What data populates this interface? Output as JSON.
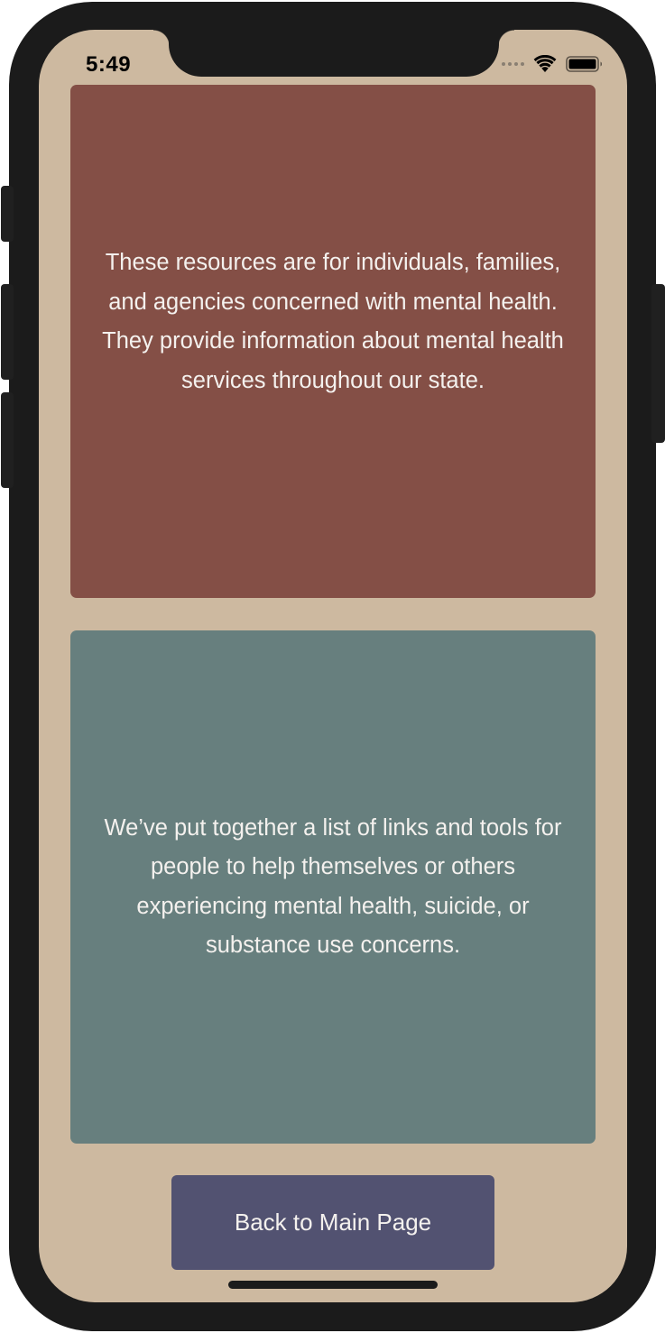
{
  "status_bar": {
    "time": "5:49",
    "icons": [
      "cellular-signal-icon",
      "wifi-icon",
      "battery-icon"
    ]
  },
  "colors": {
    "screen_background": "#cdb9a0",
    "info_card_background": "#844f46",
    "tools_card_background": "#677f7e",
    "button_background": "#525271",
    "text_light": "#f4f1ee"
  },
  "info_card": {
    "text": "These resources are for individuals, families, and agencies concerned with mental health. They provide information about mental health services throughout our state."
  },
  "tools_card": {
    "text": "We’ve put together a list of links and tools for people to help themselves or others experiencing mental health, suicide, or substance use concerns."
  },
  "footer": {
    "back_button_label": "Back to Main Page"
  }
}
